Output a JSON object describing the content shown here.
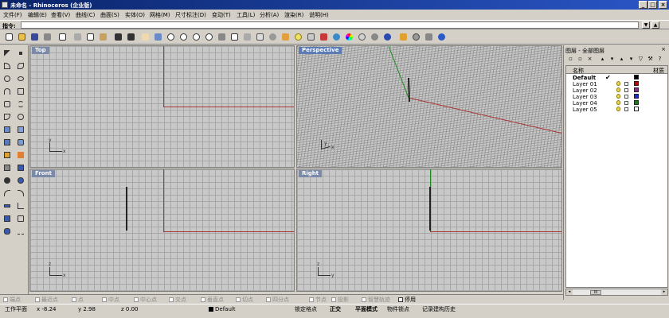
{
  "window": {
    "title": "未命名 - Rhinoceros (企业版)",
    "min_label": "_",
    "max_label": "□",
    "close_label": "×"
  },
  "menu": [
    {
      "label": "文件(F)"
    },
    {
      "label": "编辑(E)"
    },
    {
      "label": "查看(V)"
    },
    {
      "label": "曲线(C)"
    },
    {
      "label": "曲面(S)"
    },
    {
      "label": "实体(O)"
    },
    {
      "label": "网格(M)"
    },
    {
      "label": "尺寸标注(D)"
    },
    {
      "label": "变动(T)"
    },
    {
      "label": "工具(L)"
    },
    {
      "label": "分析(A)"
    },
    {
      "label": "渲染(R)"
    },
    {
      "label": "说明(H)"
    }
  ],
  "command": {
    "label": "指令:",
    "value": "",
    "arrow_label": "▼",
    "extra_label": "▲"
  },
  "viewports": {
    "top": {
      "label": "Top",
      "axis_x": "x",
      "axis_y": "y"
    },
    "perspective": {
      "label": "Perspective",
      "axis_x": "x",
      "axis_y": "y"
    },
    "front": {
      "label": "Front",
      "axis_x": "x",
      "axis_y": "z"
    },
    "right": {
      "label": "Right",
      "axis_x": "y",
      "axis_y": "z"
    }
  },
  "layers_panel": {
    "title": "图层 - 全部图层",
    "close_label": "×",
    "col_name": "名称",
    "col_material": "材质",
    "rows": [
      {
        "name": "Default",
        "current_mark": "✔",
        "color": "#000000"
      },
      {
        "name": "Layer 01",
        "color": "#c00000"
      },
      {
        "name": "Layer 02",
        "color": "#8a2a8a"
      },
      {
        "name": "Layer 03",
        "color": "#1a2ad0"
      },
      {
        "name": "Layer 04",
        "color": "#1a7a1a"
      },
      {
        "name": "Layer 05",
        "color": "#ffffff"
      }
    ],
    "scroll_thumb": "III"
  },
  "osnap": [
    {
      "label": "端点",
      "on": false
    },
    {
      "label": "最近点",
      "on": false
    },
    {
      "label": "点",
      "on": false
    },
    {
      "label": "中点",
      "on": false
    },
    {
      "label": "中心点",
      "on": false
    },
    {
      "label": "交点",
      "on": false
    },
    {
      "label": "垂直点",
      "on": false
    },
    {
      "label": "切点",
      "on": false
    },
    {
      "label": "四分点",
      "on": false
    },
    {
      "label": "节点",
      "on": false
    },
    {
      "label": "投影",
      "on": false
    },
    {
      "label": "智慧轨迹",
      "on": false
    },
    {
      "label": "停用",
      "on": true
    }
  ],
  "status": {
    "plane": "工作平面",
    "x": "x -8.24",
    "y": "y 2.98",
    "z": "z 0.00",
    "layer": "Default",
    "grid_snap": "锁定格点",
    "ortho": "正交",
    "planar": "平面模式",
    "object_snap": "物件锁点",
    "history": "记录建构历史"
  },
  "colors": {
    "title_bar": "#0a246a",
    "x_axis": "#a83232",
    "y_axis": "#1e8a1e",
    "viewport_label": "#7a8aa8"
  }
}
